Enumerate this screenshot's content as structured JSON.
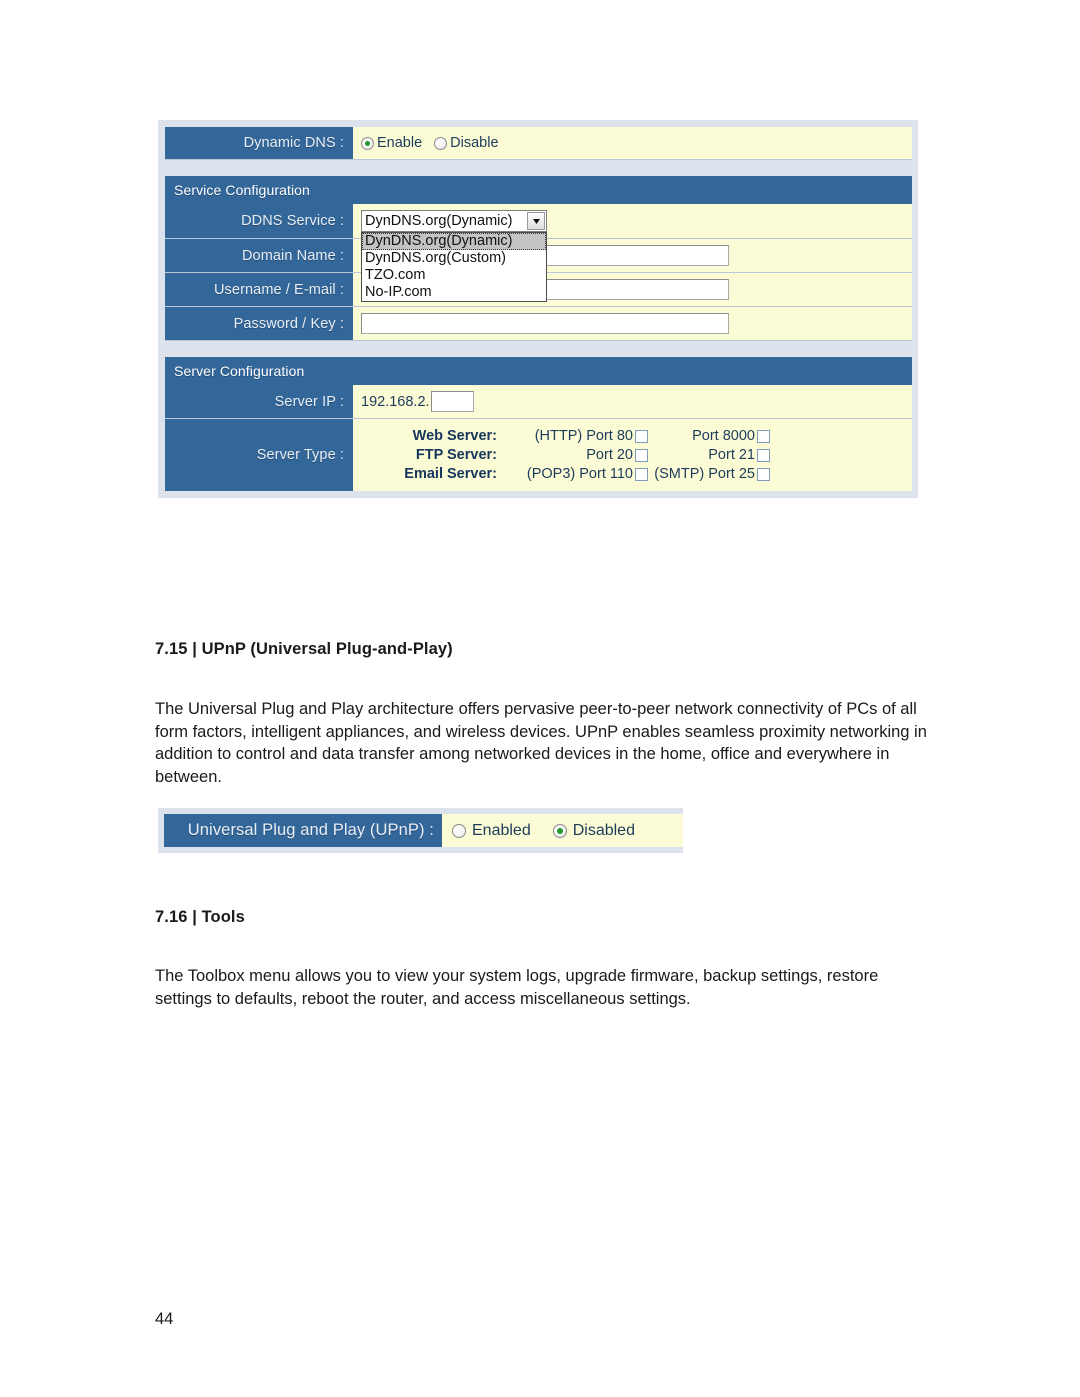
{
  "page": {
    "number": "44"
  },
  "ddns_panel": {
    "dynamic_dns": {
      "label": "Dynamic DNS :",
      "options": [
        {
          "label": "Enable",
          "checked": true
        },
        {
          "label": "Disable",
          "checked": false
        }
      ]
    },
    "service_configuration": {
      "heading": "Service Configuration",
      "ddns_service": {
        "label": "DDNS Service :",
        "value": "DynDNS.org(Dynamic)",
        "expanded": true,
        "options": [
          "DynDNS.org(Dynamic)",
          "DynDNS.org(Custom)",
          "TZO.com",
          "No-IP.com"
        ],
        "selected_index": 0
      },
      "domain_name": {
        "label": "Domain Name :",
        "value": "",
        "placeholder": ""
      },
      "username_email": {
        "label": "Username / E-mail :",
        "value": "",
        "placeholder": ""
      },
      "password_key": {
        "label": "Password / Key :",
        "value": "",
        "placeholder": ""
      }
    },
    "server_configuration": {
      "heading": "Server Configuration",
      "server_ip": {
        "label": "Server IP :",
        "prefix": "192.168.2.",
        "value": "",
        "placeholder": ""
      },
      "server_type": {
        "label": "Server Type :",
        "rows": [
          {
            "name": "Web Server:",
            "left": {
              "text": "(HTTP) Port 80",
              "checked": false
            },
            "right": {
              "text": "Port 8000",
              "checked": false
            }
          },
          {
            "name": "FTP Server:",
            "left": {
              "text": "Port 20",
              "checked": false
            },
            "right": {
              "text": "Port 21",
              "checked": false
            }
          },
          {
            "name": "Email Server:",
            "left": {
              "text": "(POP3) Port 110",
              "checked": false
            },
            "right": {
              "text": "(SMTP) Port 25",
              "checked": false
            }
          }
        ]
      }
    }
  },
  "section_715": {
    "heading": "7.15 | UPnP (Universal Plug-and-Play)",
    "paragraph": "The Universal Plug and Play architecture offers pervasive peer-to-peer network connectivity of PCs of all form factors, intelligent appliances, and wireless devices. UPnP enables seamless proximity networking in addition to control and data transfer among networked devices in the home, office and everywhere in between."
  },
  "upnp_panel": {
    "label": "Universal Plug and Play (UPnP) :",
    "options": [
      {
        "label": "Enabled",
        "checked": false
      },
      {
        "label": "Disabled",
        "checked": true
      }
    ]
  },
  "section_716": {
    "heading": "7.16 | Tools",
    "paragraph": "The Toolbox menu allows you to view your system logs, upgrade firmware, backup settings, restore settings to defaults, reboot the router, and access miscellaneous settings."
  },
  "colors": {
    "panel_blue": "#336699",
    "panel_background": "#dde3ec",
    "field_yellow": "#fbfbd5",
    "radio_checked": "#1f9c2f",
    "text_blue": "#1d3c5c"
  }
}
